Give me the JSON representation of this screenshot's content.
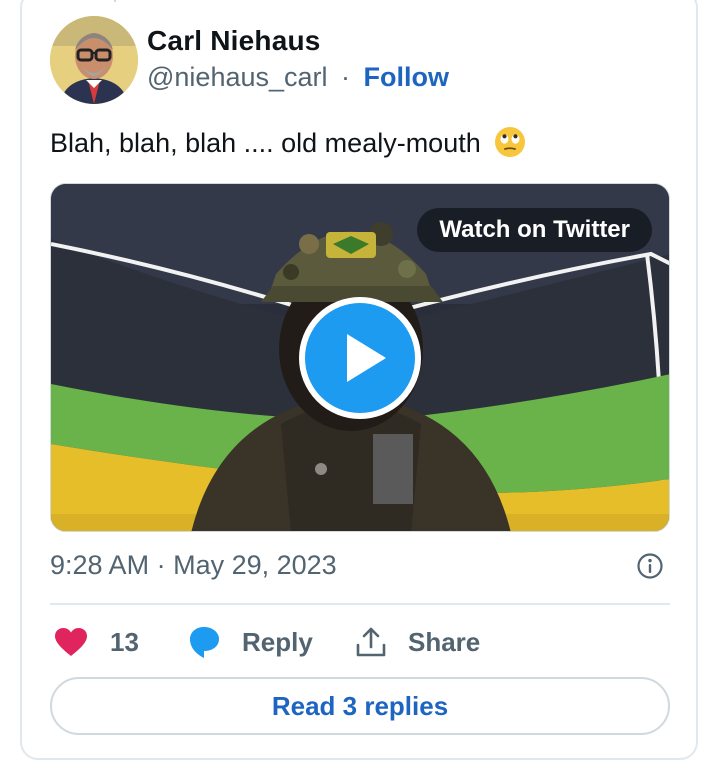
{
  "author": {
    "name": "Carl Niehaus",
    "handle": "@niehaus_carl",
    "separator": "·",
    "follow_label": "Follow"
  },
  "tweet": {
    "text": "Blah, blah, blah .... old mealy-mouth",
    "emoji": "face-with-rolling-eyes"
  },
  "media": {
    "watch_label": "Watch on Twitter"
  },
  "meta": {
    "time": "9:28 AM",
    "separator": "·",
    "date": "May 29, 2023"
  },
  "actions": {
    "like_count": "13",
    "reply_label": "Reply",
    "share_label": "Share"
  },
  "read_replies_label": "Read 3 replies",
  "colors": {
    "accent": "#1d65c1",
    "like": "#e0245e",
    "reply_icon": "#1d9bf0",
    "play": "#1d9bf0",
    "muted": "#536471"
  }
}
